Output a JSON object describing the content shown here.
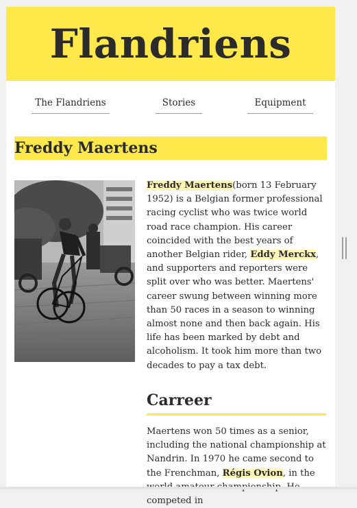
{
  "site": {
    "title": "Flandriens"
  },
  "nav": {
    "items": [
      {
        "label": "The Flandriens"
      },
      {
        "label": "Stories"
      },
      {
        "label": "Equipment"
      }
    ]
  },
  "article": {
    "heading": "Freddy Maertens",
    "photo_icon": "cyclist-photo",
    "bio": {
      "name": "Freddy Maertens",
      "text1": "(born 13 February 1952) is a Belgian former professional racing cyclist who was twice world road race champion. His career coincided with the best years of another Belgian rider, ",
      "link1": "Eddy Merckx",
      "text2": ", and supporters and reporters were split over who was better. Maertens' career swung between winning more than 50 races in a season to winning almost none and then back again. His life has been marked by debt and alcoholism. It took him more than two decades to pay a tax debt."
    },
    "career": {
      "heading": "Carreer",
      "text1": "Maertens won 50 times as a senior, including the national championship at Nandrin. In 1970 he came second to the Frenchman, ",
      "link1": "Régis Ovion",
      "text2": ", in the world amateur championship. He competed in"
    }
  },
  "colors": {
    "accent": "#ffe84a",
    "highlight": "#fff6b8",
    "text": "#2b2b2b"
  }
}
